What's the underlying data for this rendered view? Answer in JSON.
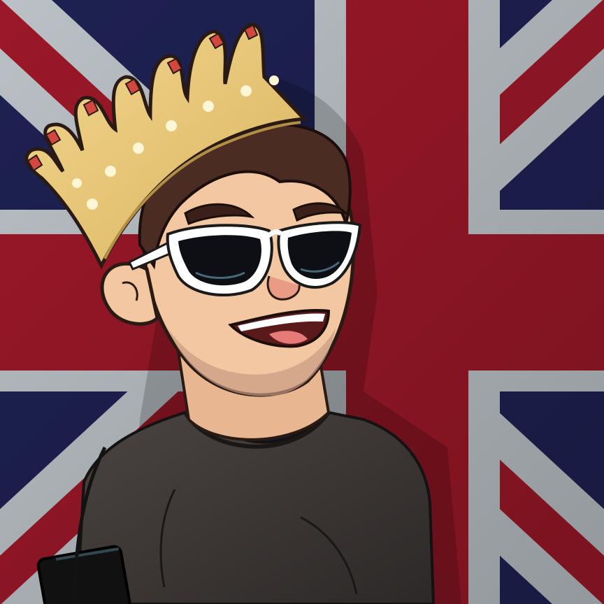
{
  "image": {
    "subject": "cartoon-avatar",
    "background": "union-jack-flag",
    "colors": {
      "flag_blue": "#1f2356",
      "flag_red": "#a3192a",
      "flag_white": "#c4cbd0",
      "crown_gold": "#e8c777",
      "crown_gem": "#d4473f",
      "skin": "#f3c7a1",
      "hair": "#4a2c23",
      "shirt": "#3b3634",
      "glasses_frame": "#ffffff",
      "lens": "#0e0f14"
    }
  }
}
